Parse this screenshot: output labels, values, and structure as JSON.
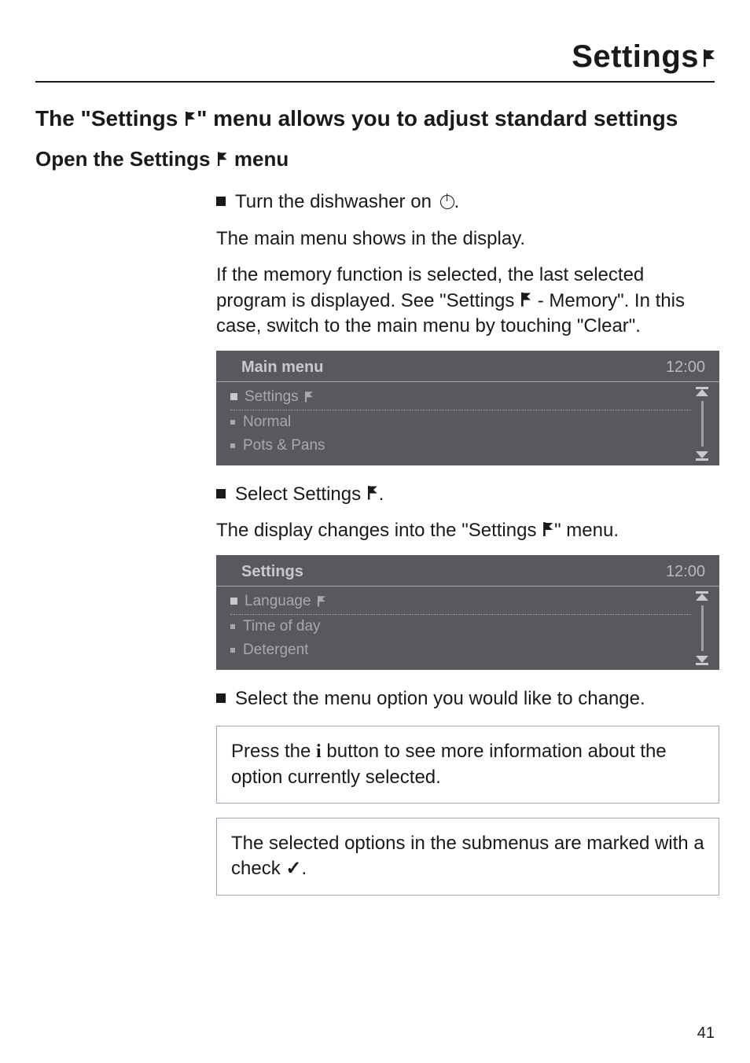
{
  "page_title": "Settings",
  "intro_heading_a": "The \"Settings ",
  "intro_heading_b": "\" menu allows you to adjust standard settings",
  "sub_heading_a": "Open the Settings ",
  "sub_heading_b": " menu",
  "step1": "Turn the dishwasher on ",
  "step1b": ".",
  "para1a": "The main menu shows in the display.",
  "para1b_a": "If the memory function is selected, the last selected program is displayed. See \"Settings ",
  "para1b_b": " - Memory\". In this case, switch to the main menu by touching \"Clear\".",
  "screen1": {
    "title": "Main menu",
    "time": "12:00",
    "rows": [
      "Settings",
      "Normal",
      "Pots & Pans"
    ],
    "has_flag": [
      true,
      false,
      false
    ]
  },
  "step2_a": "Select Settings ",
  "step2_b": ".",
  "para2_a": "The display changes into the \"Settings ",
  "para2_b": "\" menu.",
  "screen2": {
    "title": "Settings",
    "time": "12:00",
    "rows": [
      "Language",
      "Time of day",
      "Detergent"
    ],
    "has_flag": [
      true,
      false,
      false
    ]
  },
  "step3": "Select the menu option you would like to change.",
  "note1_a": "Press the ",
  "note1_b": " button to see more information about the option currently selected.",
  "note2_a": "The selected options in the submenus are marked with a check ",
  "note2_b": ".",
  "page_number": "41"
}
